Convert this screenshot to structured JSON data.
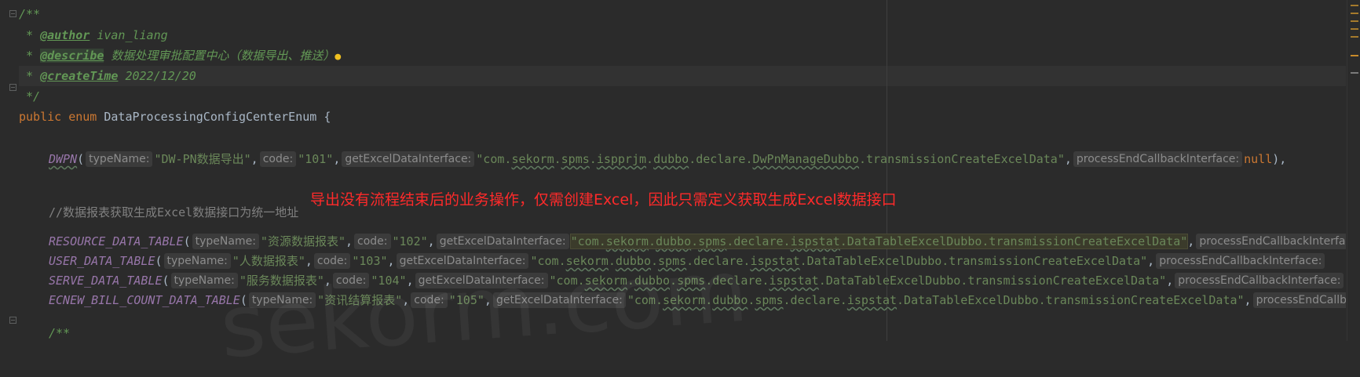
{
  "code": {
    "comment": {
      "open": "/**",
      "author_tag": "@author",
      "author_value": " ivan_liang",
      "describe_tag": "@describe",
      "describe_value": " 数据处理审批配置中心（数据导出、推送）",
      "create_tag": "@createTime",
      "create_value": " 2022/12/20",
      "close": " */"
    },
    "declaration": {
      "public": "public",
      "enum": "enum",
      "name": "DataProcessingConfigCenterEnum",
      "brace": "{"
    },
    "hints": {
      "type_name": "typeName:",
      "code": "code:",
      "get_excel": "getExcelDataInterface:",
      "process_end": "processEndCallbackInterface:"
    },
    "dwpn": {
      "name": "DWPN",
      "type_name": "\"DW-PN数据导出\"",
      "code": "\"101\"",
      "excel_interface_parts": [
        "\"com.",
        "sekorm",
        ".",
        "spms",
        ".",
        "ispprjm",
        ".",
        "dubbo",
        ".declare.",
        "DwPnManageDubbo",
        ".transmissionCreateExcelData\""
      ],
      "callback": "null"
    },
    "line_comment": "//数据报表获取生成Excel数据接口为统一地址",
    "entries": [
      {
        "name": "RESOURCE_DATA_TABLE",
        "type_name": "\"资源数据报表\"",
        "code": "\"102\"",
        "excel_interface_parts": [
          "\"com.",
          "sekorm",
          ".",
          "dubbo",
          ".",
          "spms",
          ".declare.",
          "ispstat",
          ".DataTableExcelDubbo.transmissionCreateExcelData\""
        ],
        "callback_hint": "processEndCallbackInterface:"
      },
      {
        "name": "USER_DATA_TABLE",
        "type_name": "\"人数据报表\"",
        "code": "\"103\"",
        "excel_interface_parts": [
          "\"com.",
          "sekorm",
          ".",
          "dubbo",
          ".",
          "spms",
          ".declare.",
          "ispstat",
          ".DataTableExcelDubbo.transmissionCreateExcelData\""
        ],
        "callback_hint": "processEndCallbackInterface:"
      },
      {
        "name": "SERVE_DATA_TABLE",
        "type_name": "\"服务数据报表\"",
        "code": "\"104\"",
        "excel_interface_parts": [
          "\"com.",
          "sekorm",
          ".",
          "dubbo",
          ".",
          "spms",
          ".declare.",
          "ispstat",
          ".DataTableExcelDubbo.transmissionCreateExcelData\""
        ],
        "callback_hint": "processEndCallbackInterface:"
      },
      {
        "name": "ECNEW_BILL_COUNT_DATA_TABLE",
        "type_name": "\"资讯结算报表\"",
        "code": "\"105\"",
        "excel_interface_parts": [
          "\"com.",
          "sekorm",
          ".",
          "dubbo",
          ".",
          "spms",
          ".declare.",
          "ispstat",
          ".DataTableExcelDubbo.transmissionCreateExcelData\""
        ],
        "callback_hint": "processEndCallbackInterface:"
      }
    ],
    "next_comment": "/**"
  },
  "annotation_text": "导出没有流程结束后的业务操作，仅需创建Excel，因此只需定义获取生成Excel数据接口",
  "watermark": "sekorm.com",
  "colors": {
    "background": "#2b2b2b",
    "keyword": "#cc7832",
    "string": "#6a8759",
    "comment": "#629755",
    "enum_constant": "#9876aa",
    "annotation": "#ff2a2a"
  },
  "icons": [
    "intention-bulb-icon",
    "fold-icon"
  ]
}
